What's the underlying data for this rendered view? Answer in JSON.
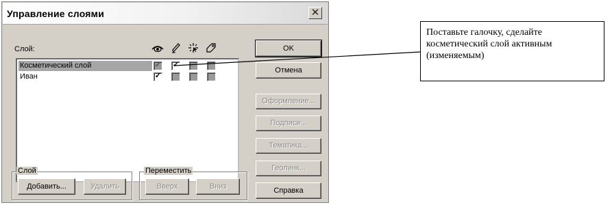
{
  "dialog": {
    "title": "Управление слоями",
    "close_glyph": "✕"
  },
  "list": {
    "header_label": "Слой:",
    "column_icons": [
      "eye-icon",
      "pencil-icon",
      "select-arrow-icon",
      "tag-icon"
    ],
    "rows": [
      {
        "name": "Косметический слой",
        "selected": true,
        "visible": true,
        "editable": true,
        "selectable": false,
        "labels": false
      },
      {
        "name": "Иван",
        "selected": false,
        "visible": true,
        "editable": false,
        "selectable": false,
        "labels": false
      }
    ]
  },
  "buttons": {
    "ok": "OK",
    "cancel": "Отмена",
    "display": "Оформление...",
    "labels": "Подписи...",
    "thematic": "Тематика...",
    "geolink": "Геолинк...",
    "help": "Справка"
  },
  "layer_group": {
    "title": "Слой",
    "add": "Добавить...",
    "remove": "Удалить"
  },
  "move_group": {
    "title": "Переместить",
    "up": "Вверх",
    "down": "Вниз"
  },
  "callout": {
    "text": "Поставьте галочку, сделайте косметический слой активным (изменяемым)"
  },
  "checkmark": "✓"
}
